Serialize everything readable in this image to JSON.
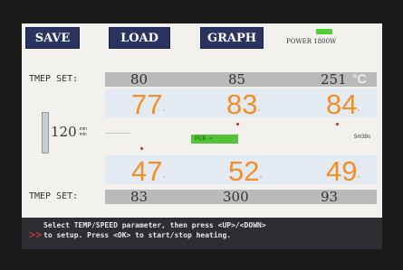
{
  "toolbar": {
    "save_label": "SAVE",
    "load_label": "LOAD",
    "graph_label": "GRAPH",
    "power_label": "POWER 1800W",
    "power_icon": "power-indicator"
  },
  "top_set": {
    "label": "TMEP SET:",
    "values": [
      "80",
      "85",
      "251"
    ],
    "unit": "°C"
  },
  "top_temps": {
    "values": [
      "77",
      "83",
      "84"
    ],
    "subs": [
      "°",
      "°",
      "°"
    ]
  },
  "speed": {
    "value": "120",
    "unit_top": "mm",
    "unit_bottom": "min",
    "side_label": "SPEED"
  },
  "status": {
    "pcb_label": "PCB  ->",
    "timer": "5m39s"
  },
  "bottom_temps": {
    "values": [
      "47",
      "52",
      "49"
    ],
    "subs": [
      "°",
      "°",
      "°"
    ]
  },
  "bottom_set": {
    "label": "TMEP SET:",
    "values": [
      "83",
      "300",
      "93"
    ]
  },
  "message": {
    "icon": ">>",
    "text": "Select TEMP/SPEED parameter, then press <UP>/<DOWN>\nto setup. Press <OK> to start/stop heating."
  },
  "colors": {
    "button_bg": "#2b3361",
    "temp_color": "#f18f28",
    "pcb_green": "#55c23a",
    "message_bg": "#2c2e34"
  }
}
